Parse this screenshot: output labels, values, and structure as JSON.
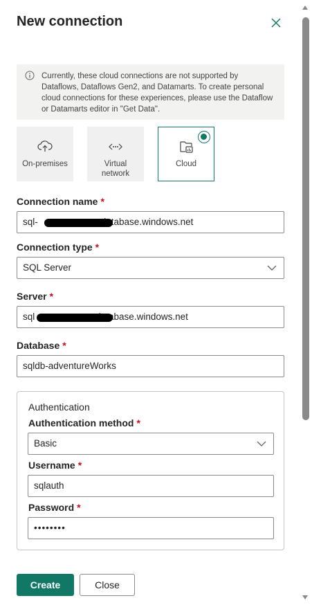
{
  "dialog": {
    "title": "New connection"
  },
  "notice": {
    "text": "Currently, these cloud connections are not supported by Dataflows, Dataflows Gen2, and Datamarts. To create personal cloud connections for these experiences, please use the Dataflow or Datamarts editor in \"Get Data\"."
  },
  "connection_types": [
    {
      "label": "On-premises",
      "icon": "cloud-upload-icon",
      "selected": false
    },
    {
      "label": "Virtual network",
      "icon": "virtual-network-icon",
      "selected": false
    },
    {
      "label": "Cloud",
      "icon": "cloud-connection-icon",
      "selected": true
    }
  ],
  "form": {
    "connection_name_label": "Connection name",
    "connection_name_prefix": "sql-",
    "connection_name_suffix": "database.windows.net",
    "connection_type_label": "Connection type",
    "connection_type_value": "SQL Server",
    "server_label": "Server",
    "server_prefix": "sql",
    "server_suffix": "database.windows.net",
    "database_label": "Database",
    "database_value": "sqldb-adventureWorks",
    "required_marker": "*"
  },
  "auth": {
    "section_title": "Authentication",
    "method_label": "Authentication method",
    "method_value": "Basic",
    "username_label": "Username",
    "username_value": "sqlauth",
    "password_label": "Password",
    "password_value": "••••••••"
  },
  "buttons": {
    "create": "Create",
    "close": "Close"
  },
  "colors": {
    "accent": "#117865",
    "required": "#c50f1f"
  }
}
